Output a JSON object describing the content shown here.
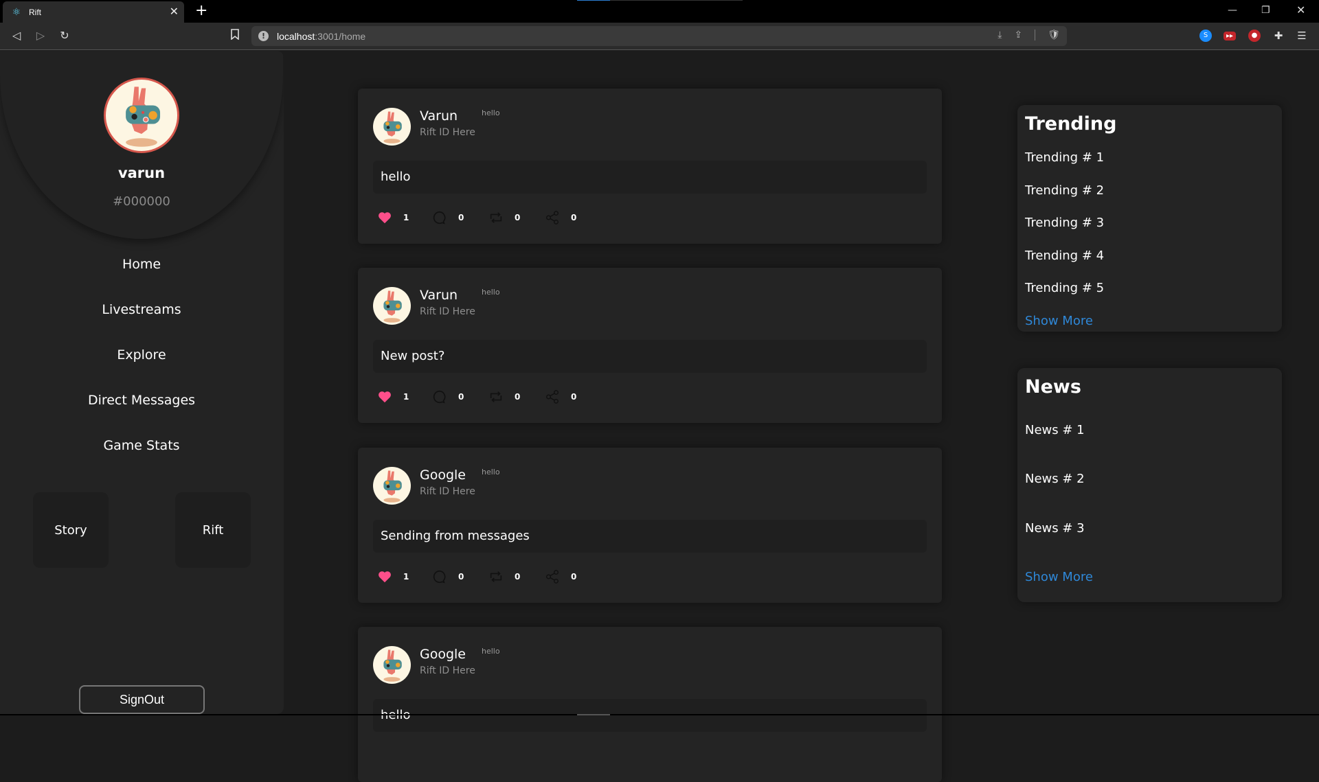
{
  "browser": {
    "tab_title": "Rift",
    "url_host": "localhost",
    "url_rest": ":3001/home",
    "extensions": [
      "shazam-extension",
      "video-speed-extension",
      "record-extension",
      "extensions-puzzle",
      "browser-menu"
    ]
  },
  "sidebar": {
    "username": "varun",
    "tag": "#000000",
    "nav": [
      {
        "label": "Home"
      },
      {
        "label": "Livestreams"
      },
      {
        "label": "Explore"
      },
      {
        "label": "Direct Messages"
      },
      {
        "label": "Game Stats"
      }
    ],
    "quick": {
      "story": "Story",
      "rift": "Rift"
    },
    "signout": "SignOut"
  },
  "posts": [
    {
      "author": "Varun",
      "sub": "Rift ID Here",
      "time": "hello",
      "content": "hello",
      "likes": "1",
      "comments": "0",
      "reposts": "0",
      "shares": "0"
    },
    {
      "author": "Varun",
      "sub": "Rift ID Here",
      "time": "hello",
      "content": "New post?",
      "likes": "1",
      "comments": "0",
      "reposts": "0",
      "shares": "0"
    },
    {
      "author": "Google",
      "sub": "Rift ID Here",
      "time": "hello",
      "content": "Sending from messages",
      "likes": "1",
      "comments": "0",
      "reposts": "0",
      "shares": "0"
    },
    {
      "author": "Google",
      "sub": "Rift ID Here",
      "time": "hello",
      "content": "hello"
    }
  ],
  "trending": {
    "title": "Trending",
    "items": [
      "Trending # 1",
      "Trending # 2",
      "Trending # 3",
      "Trending # 4",
      "Trending # 5"
    ],
    "show_more": "Show More"
  },
  "news": {
    "title": "News",
    "items": [
      "News # 1",
      "News # 2",
      "News # 3"
    ],
    "show_more": "Show More"
  },
  "colors": {
    "accent_link": "#2f88d8",
    "like_heart": "#ff4f8b",
    "avatar_ring": "#d5574c"
  }
}
